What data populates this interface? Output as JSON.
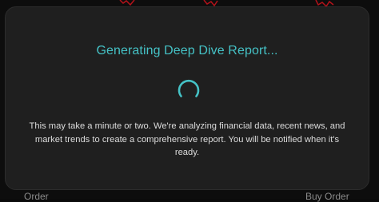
{
  "background": {
    "order_left_label": "Order",
    "order_right_label": "Buy Order",
    "accent_color": "#c0141c"
  },
  "modal": {
    "title": "Generating Deep Dive Report...",
    "message": "This may take a minute or two. We're analyzing financial data, recent news, and market trends to create a comprehensive report. You will be notified when it's ready.",
    "title_color": "#45c2c6",
    "spinner_icon": "loading-spinner-icon"
  }
}
